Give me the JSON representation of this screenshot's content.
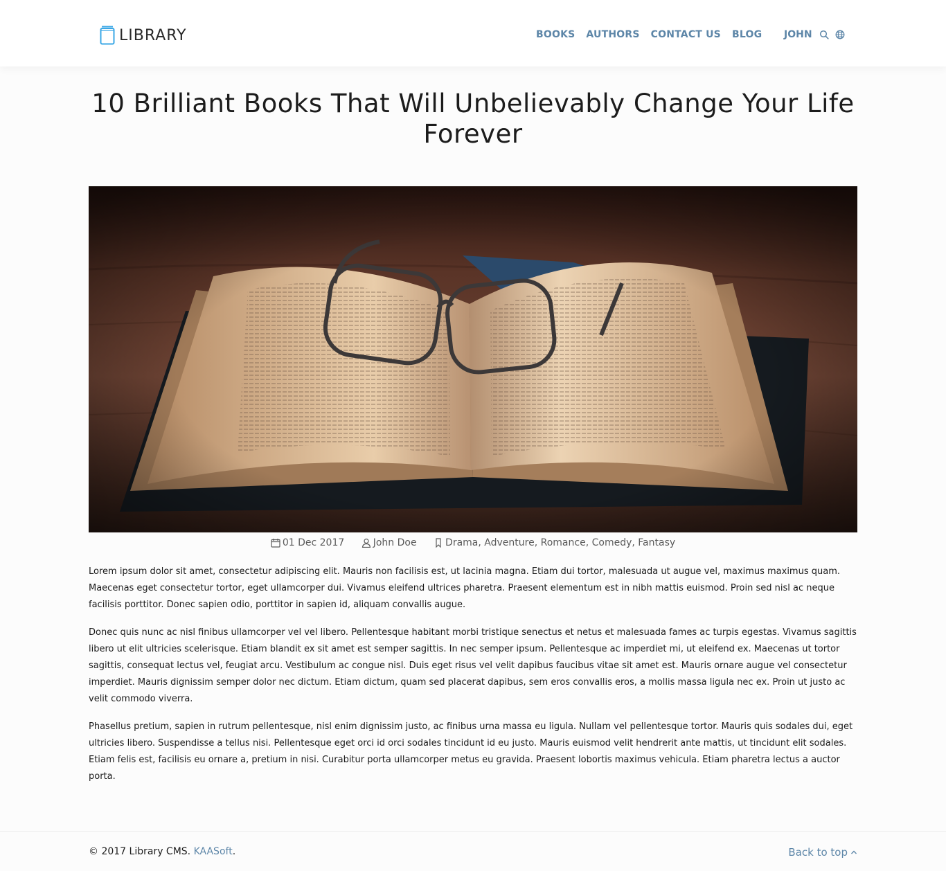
{
  "header": {
    "logo_text": "LIBRARY",
    "nav": [
      {
        "label": "BOOKS"
      },
      {
        "label": "AUTHORS"
      },
      {
        "label": "CONTACT US"
      },
      {
        "label": "BLOG"
      }
    ],
    "user_label": "JOHN",
    "icons": [
      "book-icon",
      "search-icon",
      "globe-icon"
    ]
  },
  "post": {
    "title": "10 Brilliant Books That Will Unbelievably Change Your Life Forever",
    "meta": {
      "date": "01 Dec 2017",
      "author": "John Doe",
      "genres": [
        "Drama",
        "Adventure",
        "Romance",
        "Comedy",
        "Fantasy"
      ]
    },
    "paragraphs": [
      "Lorem ipsum dolor sit amet, consectetur adipiscing elit. Mauris non facilisis est, ut lacinia magna. Etiam dui tortor, malesuada ut augue vel, maximus maximus quam. Maecenas eget consectetur tortor, eget ullamcorper dui. Vivamus eleifend ultrices pharetra. Praesent elementum est in nibh mattis euismod. Proin sed nisl ac neque facilisis porttitor. Donec sapien odio, porttitor in sapien id, aliquam convallis augue.",
      "Donec quis nunc ac nisl finibus ullamcorper vel vel libero. Pellentesque habitant morbi tristique senectus et netus et malesuada fames ac turpis egestas. Vivamus sagittis libero ut elit ultricies scelerisque. Etiam blandit ex sit amet est semper sagittis. In nec semper ipsum. Pellentesque ac imperdiet mi, ut eleifend ex. Maecenas ut tortor sagittis, consequat lectus vel, feugiat arcu. Vestibulum ac congue nisl. Duis eget risus vel velit dapibus faucibus vitae sit amet est. Mauris ornare augue vel consectetur imperdiet. Mauris dignissim semper dolor nec dictum. Etiam dictum, quam sed placerat dapibus, sem eros convallis eros, a mollis massa ligula nec ex. Proin ut justo ac velit commodo viverra.",
      "Phasellus pretium, sapien in rutrum pellentesque, nisl enim dignissim justo, ac finibus urna massa eu ligula. Nullam vel pellentesque tortor. Mauris quis sodales dui, eget ultricies libero. Suspendisse a tellus nisi. Pellentesque eget orci id orci sodales tincidunt id eu justo. Mauris euismod velit hendrerit ante mattis, ut tincidunt elit sodales. Etiam felis est, facilisis eu ornare a, pretium in nisi. Curabitur porta ullamcorper metus eu gravida. Praesent lobortis maximus vehicula. Etiam pharetra lectus a auctor porta."
    ]
  },
  "footer": {
    "copyright_prefix": "© 2017 Library CMS. ",
    "brand": "KAASoft",
    "copyright_suffix": ".",
    "back_to_top": "Back to top"
  },
  "colors": {
    "accent": "#5d86a8",
    "logo_icon": "#3aa7e6",
    "text": "#1c1c1c",
    "background": "#fcfcfc"
  }
}
